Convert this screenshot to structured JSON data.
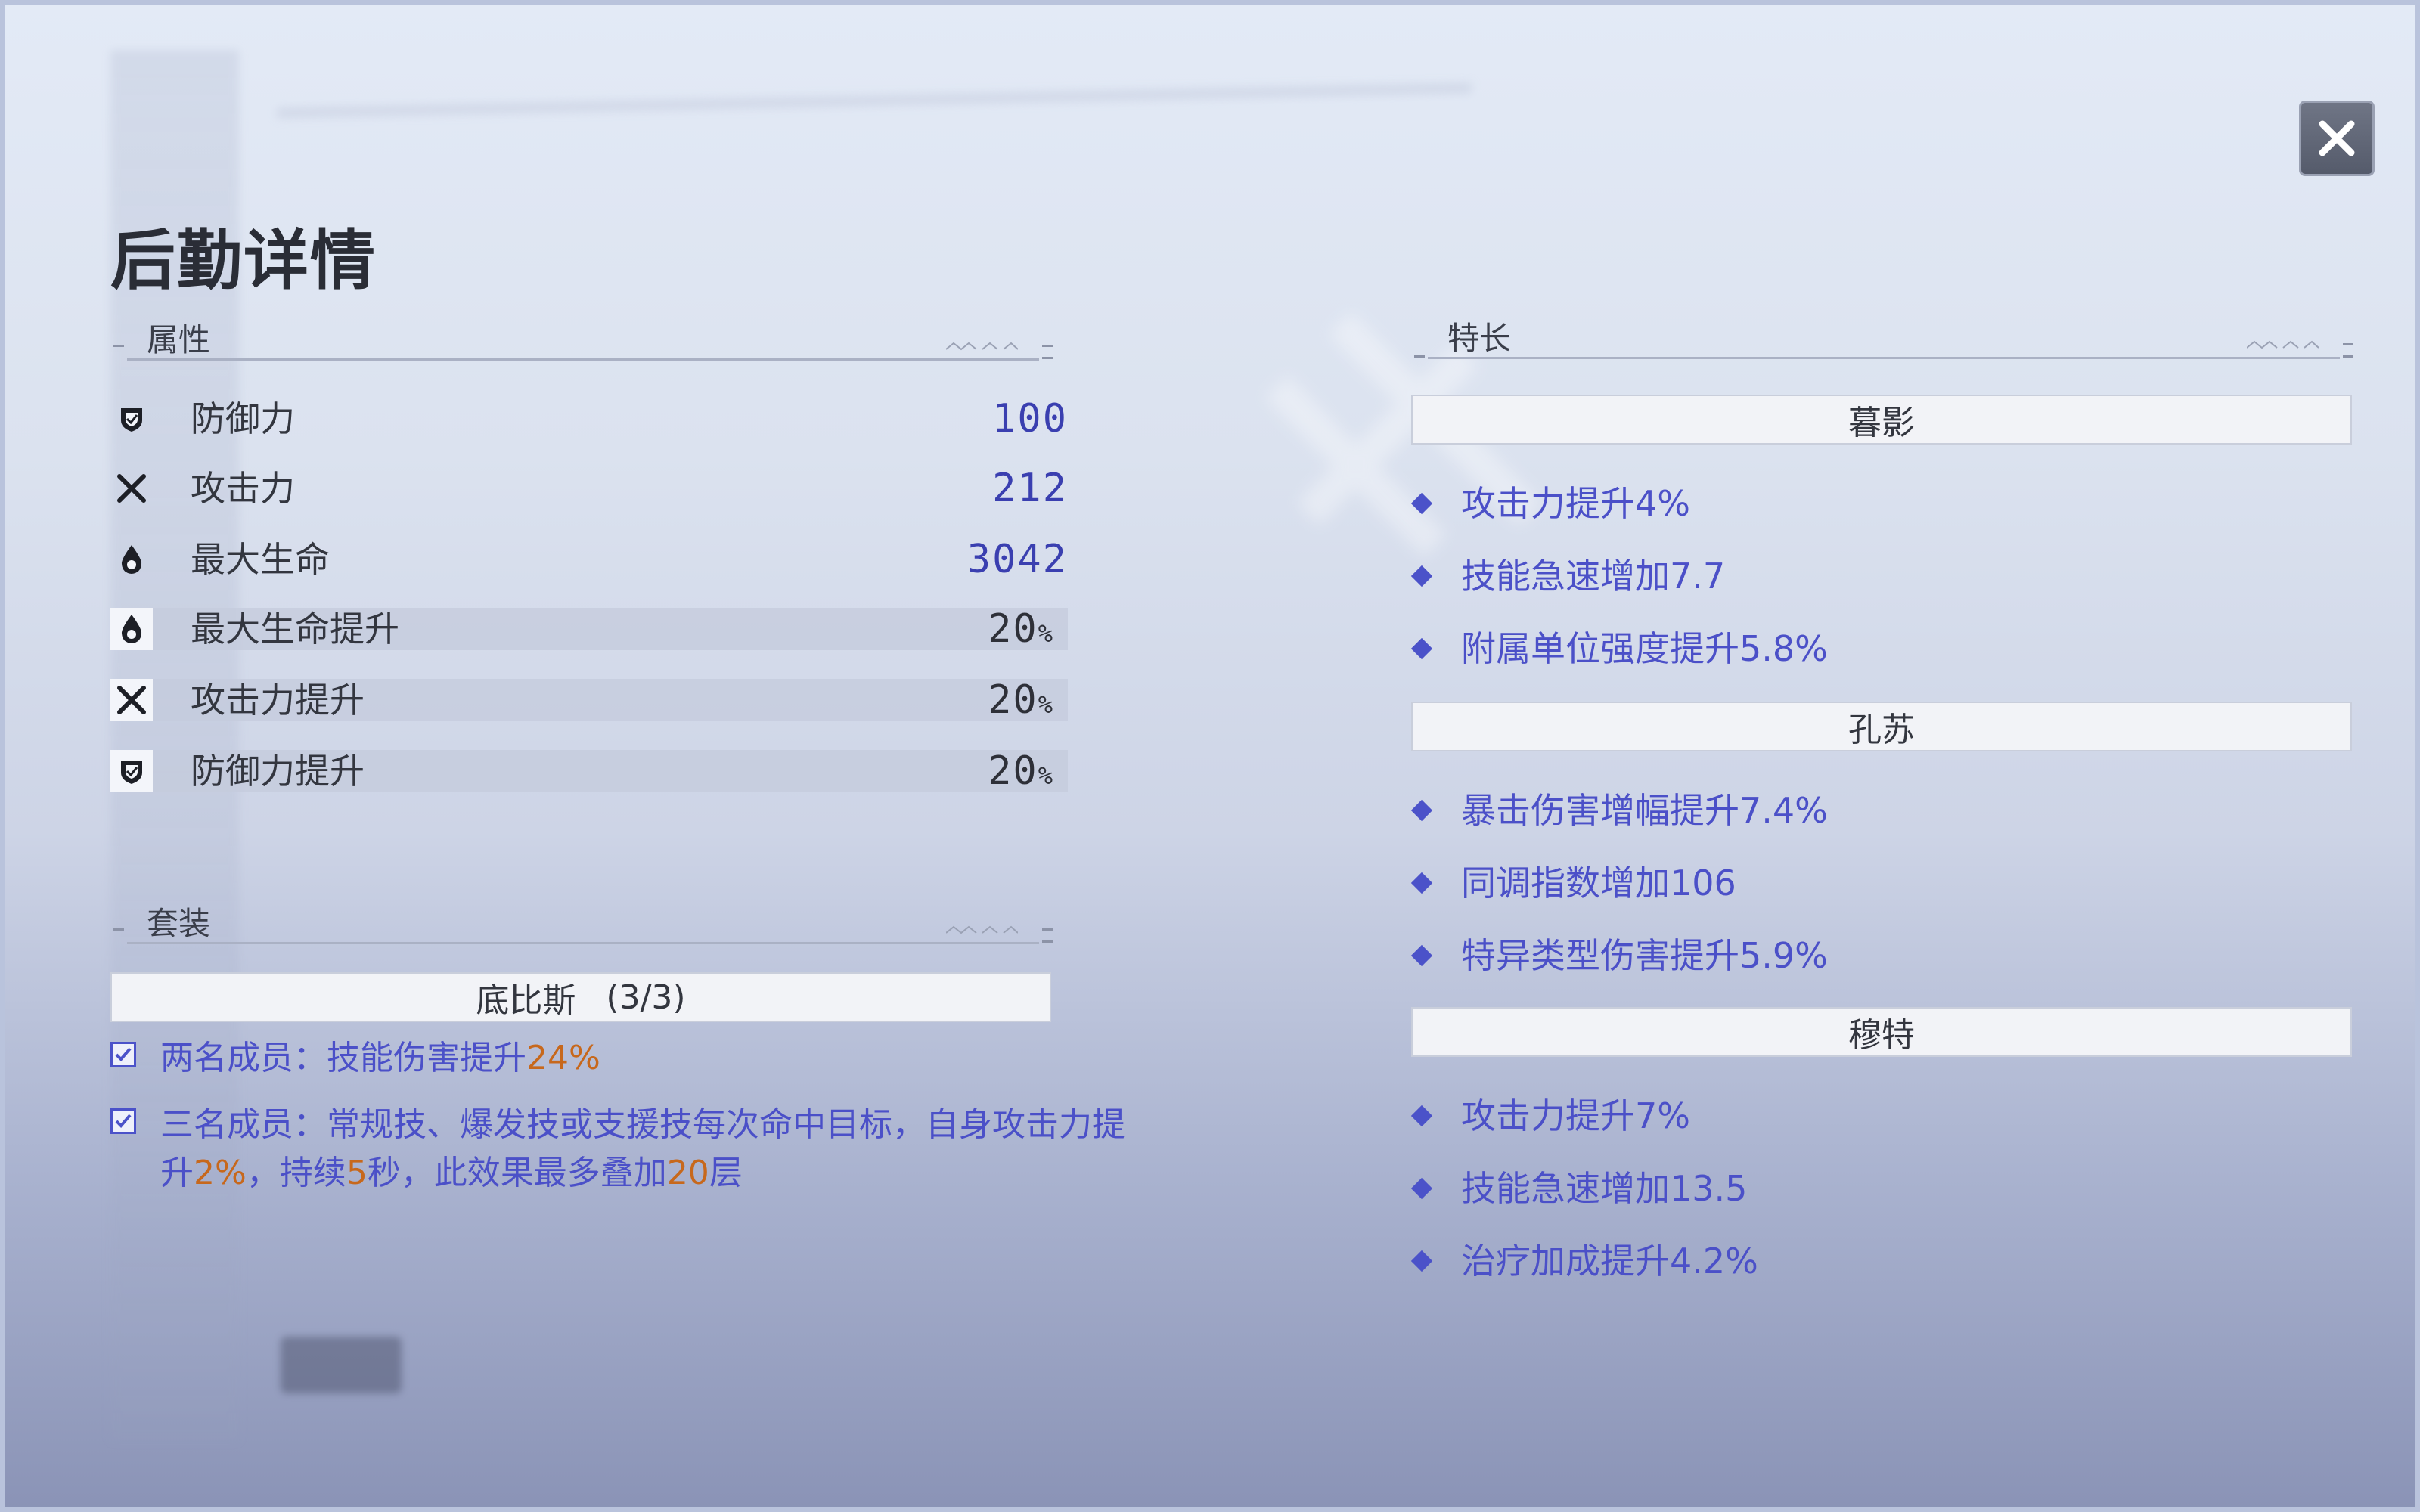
{
  "title": "后勤详情",
  "attributes": {
    "header": "属性",
    "rows": [
      {
        "icon": "shield-icon",
        "name": "防御力",
        "value": "100",
        "unit": ""
      },
      {
        "icon": "crossed-swords-icon",
        "name": "攻击力",
        "value": "212",
        "unit": ""
      },
      {
        "icon": "droplet-icon",
        "name": "最大生命",
        "value": "3042",
        "unit": ""
      },
      {
        "icon": "droplet-icon",
        "name": "最大生命提升",
        "value": "20",
        "unit": "%"
      },
      {
        "icon": "crossed-swords-icon",
        "name": "攻击力提升",
        "value": "20",
        "unit": "%"
      },
      {
        "icon": "shield-icon",
        "name": "防御力提升",
        "value": "20",
        "unit": "%"
      }
    ]
  },
  "set": {
    "header": "套装",
    "name": "底比斯",
    "count": "(3/3)",
    "effects": [
      {
        "checked": true,
        "parts": [
          {
            "text": "两名成员：技能伤害提升",
            "hl": false
          },
          {
            "text": "24%",
            "hl": true
          }
        ]
      },
      {
        "checked": true,
        "parts": [
          {
            "text": "三名成员：常规技、爆发技或支援技每次命中目标，自身攻击力提升",
            "hl": false
          },
          {
            "text": "2%",
            "hl": true
          },
          {
            "text": "，持续",
            "hl": false
          },
          {
            "text": "5",
            "hl": true
          },
          {
            "text": "秒，此效果最多叠加",
            "hl": false
          },
          {
            "text": "20",
            "hl": true
          },
          {
            "text": "层",
            "hl": false
          }
        ]
      }
    ]
  },
  "specialties": {
    "header": "特长",
    "groups": [
      {
        "name": "暮影",
        "items": [
          "攻击力提升4%",
          "技能急速增加7.7",
          "附属单位强度提升5.8%"
        ]
      },
      {
        "name": "孔苏",
        "items": [
          "暴击伤害增幅提升7.4%",
          "同调指数增加106",
          "特异类型伤害提升5.9%"
        ]
      },
      {
        "name": "穆特",
        "items": [
          "攻击力提升7%",
          "技能急速增加13.5",
          "治疗加成提升4.2%"
        ]
      }
    ]
  },
  "colors": {
    "accent": "#4b50c8",
    "highlight": "#c7681c",
    "value": "#3a3fb0"
  }
}
